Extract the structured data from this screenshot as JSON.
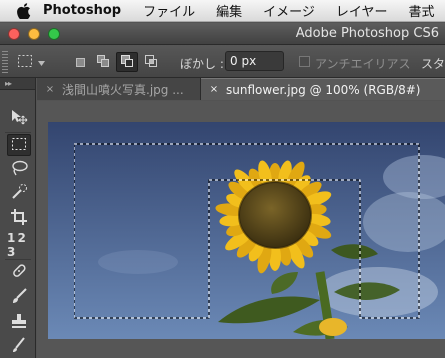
{
  "menubar": {
    "apple_icon": "apple-logo-icon",
    "app_name": "Photoshop",
    "items": [
      "ファイル",
      "編集",
      "イメージ",
      "レイヤー",
      "書式"
    ]
  },
  "window": {
    "title": "Adobe Photoshop CS6",
    "traffic_lights": {
      "close": "#fc615d",
      "minimize": "#fdbc40",
      "zoom": "#34c84a"
    }
  },
  "options_bar": {
    "tool_preset_icon": "rect-marquee-icon",
    "selection_modes": [
      "new-selection-icon",
      "add-selection-icon",
      "subtract-selection-icon",
      "intersect-selection-icon"
    ],
    "feather_label": "ぼかし :",
    "feather_value": "0 px",
    "antialias_label": "アンチエイリアス",
    "style_label": "スタ"
  },
  "tools": {
    "panel_handle": "▸▸",
    "items": [
      "move-icon",
      "rect-marquee-icon",
      "lasso-icon",
      "quick-select-icon",
      "crop-icon",
      "eyedropper-icon",
      "healing-brush-icon",
      "brush-icon",
      "clone-stamp-icon",
      "history-brush-icon"
    ],
    "eyedropper_label": "1 2 3",
    "selected": "rect-marquee-icon"
  },
  "tabs": [
    {
      "label": "浅間山噴火写真.jpg ...",
      "close": "×",
      "active": false
    },
    {
      "label": "sunflower.jpg @ 100% (RGB/8#)",
      "close": "×",
      "active": true
    }
  ],
  "colors": {
    "sky_top": "#3a4d7a",
    "sky_bottom": "#6b88b5",
    "petal": "#f2bf1c",
    "disc": "#5a4a1c",
    "leaf": "#3f5a1f"
  }
}
